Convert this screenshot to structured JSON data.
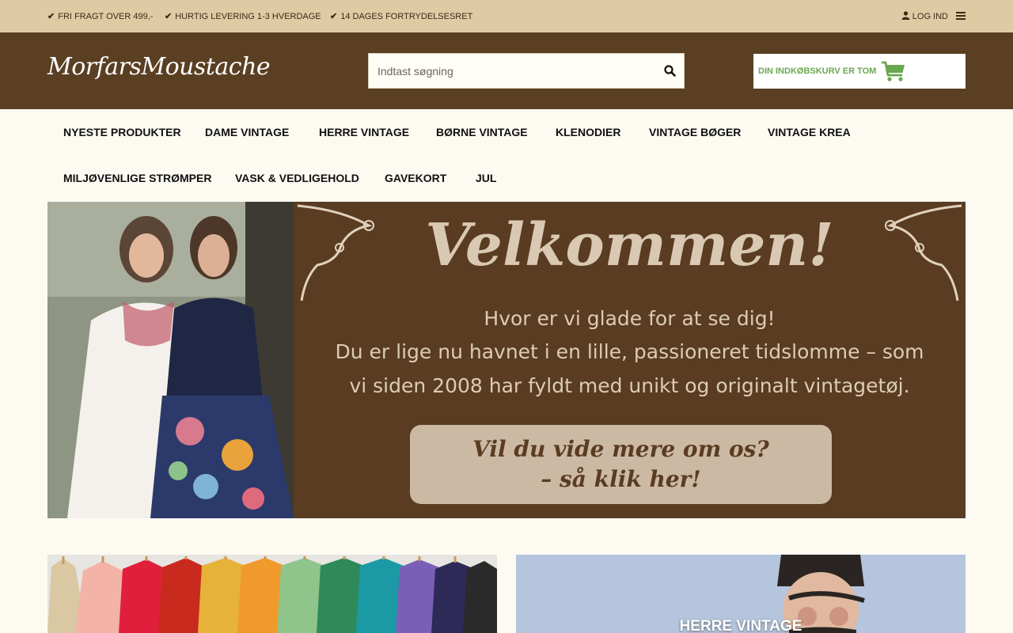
{
  "topbar": {
    "usps": [
      "FRI FRAGT OVER 499,-",
      "HURTIG LEVERING 1-3 HVERDAGE",
      "14 DAGES FORTRYDELSESRET"
    ],
    "login_label": "LOG IND"
  },
  "header": {
    "logo_text": "MorfarsMoustache",
    "search_placeholder": "Indtast søgning",
    "search_value": "",
    "cart_label": "DIN INDKØBSKURV ER TOM"
  },
  "nav": {
    "items": [
      "NYESTE PRODUKTER",
      "DAME VINTAGE",
      "HERRE VINTAGE",
      "BØRNE VINTAGE",
      "KLENODIER",
      "VINTAGE BØGER",
      "VINTAGE KREA",
      "MILJØVENLIGE STRØMPER",
      "VASK & VEDLIGEHOLD",
      "GAVEKORT",
      "JUL"
    ]
  },
  "hero": {
    "title": "Velkommen!",
    "lines": [
      "Hvor er vi glade for at se dig!",
      "Du er lige nu havnet i en lille, passioneret tidslomme – som",
      "vi siden 2008 har fyldt med unikt og originalt vintagetøj."
    ],
    "cta_lines": [
      "Vil du vide mere om os?",
      "– så klik her!"
    ]
  },
  "tiles": {
    "right_label": "HERRE VINTAGE"
  },
  "colors": {
    "topbar_bg": "#dfcba3",
    "header_bg": "#5a3f23",
    "cart_accent": "#6aa84f",
    "page_bg": "#fdfaf2",
    "hero_bg": "#5a3c22"
  },
  "icons": [
    "check-icon",
    "user-icon",
    "hamburger-menu-icon",
    "search-icon",
    "shopping-cart-icon"
  ]
}
